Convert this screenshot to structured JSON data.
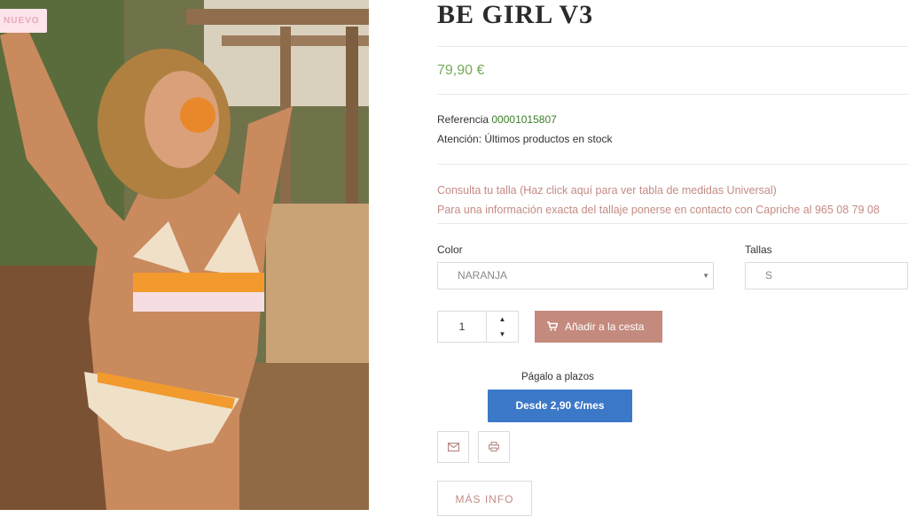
{
  "product": {
    "badge": "NUEVO",
    "title": "BE GIRL V3",
    "price": "79,90 €",
    "reference_label": "Referencia",
    "reference_value": "00001015807",
    "stock_label": "Atención:",
    "stock_value": "Últimos productos en stock",
    "size_guide_link": "Consulta tu talla (Haz click aquí para ver tabla de medidas Universal)",
    "size_contact": "Para una información exacta del tallaje ponerse en contacto con Capriche al 965 08 79 08"
  },
  "options": {
    "color_label": "Color",
    "color_value": "NARANJA",
    "size_label": "Tallas",
    "size_value": "S"
  },
  "cart": {
    "quantity": "1",
    "add_label": "Añadir a la cesta"
  },
  "financing": {
    "label": "Págalo a plazos",
    "button": "Desde 2,90 €/mes"
  },
  "more_info": "MÁS INFO",
  "colors": {
    "accent": "#c48a7e",
    "price": "#76a95a",
    "financing": "#3c78c8"
  },
  "icons": [
    "cart-icon",
    "mail-icon",
    "print-icon",
    "chevron-up-icon",
    "chevron-down-icon"
  ]
}
